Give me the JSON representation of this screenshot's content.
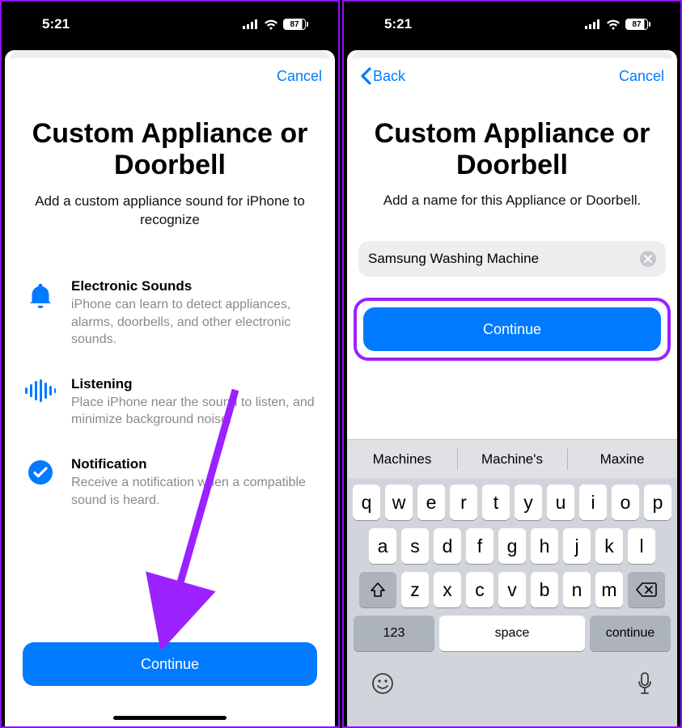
{
  "status": {
    "time": "5:21",
    "battery": "87"
  },
  "left": {
    "nav": {
      "cancel": "Cancel"
    },
    "title": "Custom Appliance or Doorbell",
    "subtitle": "Add a custom appliance sound for iPhone to recognize",
    "features": [
      {
        "title": "Electronic Sounds",
        "desc": "iPhone can learn to detect appliances, alarms, doorbells, and other electronic sounds."
      },
      {
        "title": "Listening",
        "desc": "Place iPhone near the sound to listen, and minimize background noise."
      },
      {
        "title": "Notification",
        "desc": "Receive a notification when a compatible sound is heard."
      }
    ],
    "continue": "Continue"
  },
  "right": {
    "nav": {
      "back": "Back",
      "cancel": "Cancel"
    },
    "title": "Custom Appliance or Doorbell",
    "subtitle": "Add a name for this Appliance or Doorbell.",
    "field_value": "Samsung Washing Machine",
    "continue": "Continue",
    "suggestions": [
      "Machines",
      "Machine's",
      "Maxine"
    ],
    "keyboard": {
      "rows": [
        [
          "q",
          "w",
          "e",
          "r",
          "t",
          "y",
          "u",
          "i",
          "o",
          "p"
        ],
        [
          "a",
          "s",
          "d",
          "f",
          "g",
          "h",
          "j",
          "k",
          "l"
        ],
        [
          "z",
          "x",
          "c",
          "v",
          "b",
          "n",
          "m"
        ]
      ],
      "num": "123",
      "space": "space",
      "return": "continue"
    }
  }
}
